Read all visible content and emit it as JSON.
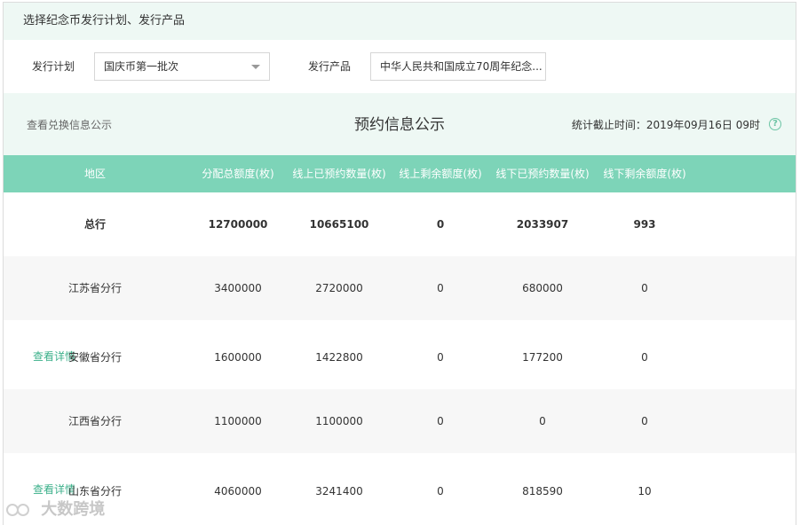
{
  "header": {
    "title": "选择纪念币发行计划、发行产品"
  },
  "filters": {
    "plan_label": "发行计划",
    "plan_value": "国庆币第一批次",
    "product_label": "发行产品",
    "product_value": "中华人民共和国成立70周年纪念..."
  },
  "info": {
    "exchange_link": "查看兑换信息公示",
    "title": "预约信息公示",
    "stat_time": "统计截止时间：2019年09月16日   09时",
    "help_glyph": "?"
  },
  "table": {
    "headers": [
      "地区",
      "分配总额度(枚)",
      "线上已预约数量(枚)",
      "线上剩余额度(枚)",
      "线下已预约数量(枚)",
      "线下剩余额度(枚)"
    ],
    "rows": [
      {
        "region": "总行",
        "total": "12700000",
        "online_booked": "10665100",
        "online_left": "0",
        "offline_booked": "2033907",
        "offline_left": "993"
      },
      {
        "region": "江苏省分行",
        "total": "3400000",
        "online_booked": "2720000",
        "online_left": "0",
        "offline_booked": "680000",
        "offline_left": "0"
      },
      {
        "region": "安徽省分行",
        "total": "1600000",
        "online_booked": "1422800",
        "online_left": "0",
        "offline_booked": "177200",
        "offline_left": "0",
        "detail": "查看详情"
      },
      {
        "region": "江西省分行",
        "total": "1100000",
        "online_booked": "1100000",
        "online_left": "0",
        "offline_booked": "0",
        "offline_left": "0"
      },
      {
        "region": "山东省分行",
        "total": "4060000",
        "online_booked": "3241400",
        "online_left": "0",
        "offline_booked": "818590",
        "offline_left": "10",
        "detail": "查看详情"
      }
    ]
  },
  "watermark": {
    "text": "大数跨境"
  }
}
